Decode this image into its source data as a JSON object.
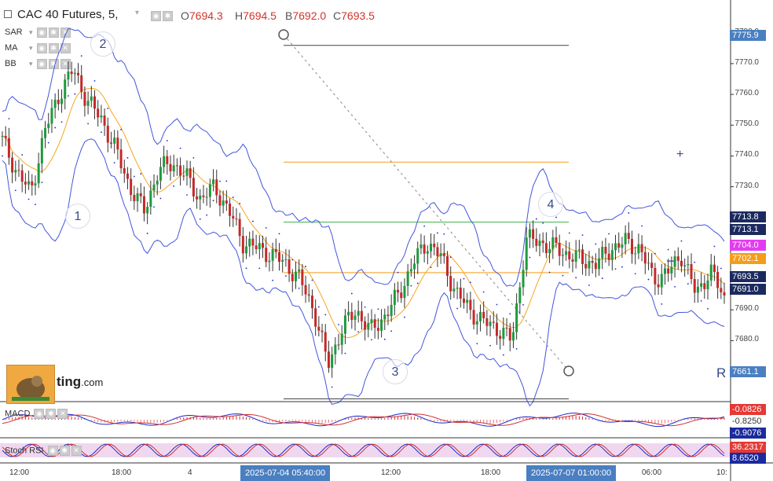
{
  "header": {
    "symbol": "CAC 40 Futures, 5,",
    "open_label": "O",
    "open": "7694.3",
    "high_label": "H",
    "high": "7694.5",
    "low_label": "B",
    "low": "7692.0",
    "close_label": "C",
    "close": "7693.5"
  },
  "indicators": [
    {
      "label": "SAR"
    },
    {
      "label": "MA"
    },
    {
      "label": "BB"
    }
  ],
  "price_axis": {
    "ticks": [
      "7780.0",
      "7770.0",
      "7760.0",
      "7750.0",
      "7740.0",
      "7730.0",
      "7720.0",
      "7710.0",
      "7700.0",
      "7690.0",
      "7680.0",
      "7670.0"
    ],
    "ylim": [
      7663,
      7783
    ]
  },
  "price_tags": [
    {
      "value": "7775.9",
      "color": "#4a7fc1"
    },
    {
      "value": "7713.8",
      "color": "#1b2a5e"
    },
    {
      "value": "7713.1",
      "color": "#1b2a5e"
    },
    {
      "value": "7704.0",
      "color": "#e33cf0"
    },
    {
      "value": "7702.1",
      "color": "#f59c1a"
    },
    {
      "value": "7693.5",
      "color": "#1b2a5e"
    },
    {
      "value": "7691.0",
      "color": "#1b2a5e"
    },
    {
      "value": "7661.1",
      "color": "#4a7fc1"
    }
  ],
  "fib": {
    "levels": [
      {
        "price": 7775.9,
        "color": "#444444"
      },
      {
        "price": 7738,
        "color": "#f59c1a"
      },
      {
        "price": 7718.5,
        "color": "#3cb043"
      },
      {
        "price": 7702.1,
        "color": "#f59c1a"
      },
      {
        "price": 7661.1,
        "color": "#444444"
      }
    ]
  },
  "wave_labels": [
    "1",
    "2",
    "3",
    "4"
  ],
  "markers": {
    "plus": "+",
    "minus": "−",
    "r": "R"
  },
  "macd": {
    "label": "MACD",
    "values": [
      "-0.0826",
      "-0.8250",
      "-0.9076"
    ],
    "colors": [
      "#e53935",
      "#e53935",
      "#1b2a9e"
    ]
  },
  "stoch": {
    "label": "Stoch RSI",
    "values": [
      "36.2317",
      "8.6520"
    ],
    "colors": [
      "#e53935",
      "#1b2a9e"
    ]
  },
  "time_axis": {
    "labels": [
      "12:00",
      "18:00",
      "4",
      "12:00",
      "18:00",
      "06:00",
      "10:"
    ],
    "highlights": [
      "2025-07-04 05:40:00",
      "2025-07-07 01:00:00"
    ]
  },
  "logo": {
    "text_bold": "ting",
    "text_light": ".com"
  },
  "chart_data": {
    "type": "candlestick",
    "title": "CAC 40 Futures, 5,",
    "ylim": [
      7663,
      7783
    ],
    "approx_closes": [
      7745,
      7735,
      7728,
      7748,
      7760,
      7768,
      7758,
      7752,
      7742,
      7730,
      7722,
      7735,
      7738,
      7733,
      7726,
      7730,
      7722,
      7712,
      7710,
      7708,
      7705,
      7700,
      7690,
      7672,
      7684,
      7690,
      7683,
      7688,
      7695,
      7705,
      7712,
      7707,
      7696,
      7690,
      7686,
      7684,
      7680,
      7713,
      7712,
      7710,
      7708,
      7706,
      7705,
      7710,
      7712,
      7710,
      7700,
      7702,
      7708,
      7695,
      7703,
      7693.5
    ]
  }
}
